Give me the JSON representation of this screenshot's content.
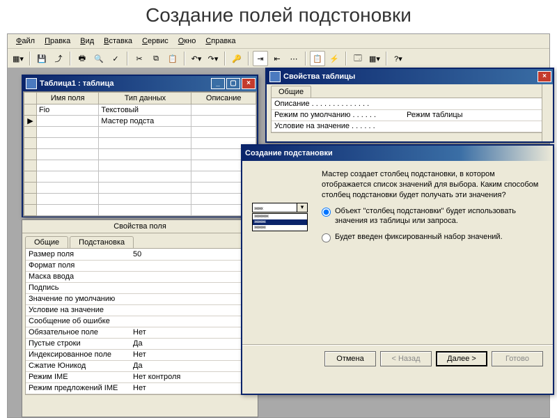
{
  "slide": {
    "title": "Создание полей подстоновки"
  },
  "menubar": [
    {
      "u": "Ф",
      "r": "айл"
    },
    {
      "u": "П",
      "r": "равка"
    },
    {
      "u": "В",
      "r": "ид"
    },
    {
      "u": "В",
      "r": "ставка"
    },
    {
      "u": "С",
      "r": "ервис"
    },
    {
      "u": "О",
      "r": "кно"
    },
    {
      "u": "С",
      "r": "правка"
    }
  ],
  "tableWin": {
    "title": "Таблица1 : таблица",
    "cols": [
      "Имя поля",
      "Тип данных",
      "Описание"
    ],
    "rows": [
      {
        "name": "Fio",
        "type": "Текстовый"
      },
      {
        "name": "",
        "type": "Мастер подста"
      }
    ]
  },
  "fieldProps": {
    "title": "Свойства поля",
    "tabs": [
      "Общие",
      "Подстановка"
    ],
    "rows": [
      {
        "n": "Размер поля",
        "v": "50"
      },
      {
        "n": "Формат поля",
        "v": ""
      },
      {
        "n": "Маска ввода",
        "v": ""
      },
      {
        "n": "Подпись",
        "v": ""
      },
      {
        "n": "Значение по умолчанию",
        "v": ""
      },
      {
        "n": "Условие на значение",
        "v": ""
      },
      {
        "n": "Сообщение об ошибке",
        "v": ""
      },
      {
        "n": "Обязательное поле",
        "v": "Нет"
      },
      {
        "n": "Пустые строки",
        "v": "Да"
      },
      {
        "n": "Индексированное поле",
        "v": "Нет"
      },
      {
        "n": "Сжатие Юникод",
        "v": "Да"
      },
      {
        "n": "Режим IME",
        "v": "Нет контроля"
      },
      {
        "n": "Режим предложений IME",
        "v": "Нет"
      }
    ]
  },
  "tprops": {
    "title": "Свойства таблицы",
    "tab": "Общие",
    "rows": [
      {
        "n": "Описание  . . . . . . . . . . . . . .",
        "v": ""
      },
      {
        "n": "Режим по умолчанию  . . . . . .",
        "v": "Режим таблицы"
      },
      {
        "n": "Условие на значение  . . . . . .",
        "v": ""
      }
    ]
  },
  "wizard": {
    "title": "Создание  подстановки",
    "intro": "Мастер создает столбец подстановки, в котором отображается список значений для выбора.  Каким способом столбец подстановки будет получать эти значения?",
    "option1": "Объект \"столбец подстановки\" будет использовать значения из таблицы или запроса.",
    "option2": "Будет введен фиксированный набор значений.",
    "img_items": [
      "xxxxxx",
      "xxxxxxxxxx",
      "xxxxxxxx",
      "xxxxxxxx"
    ],
    "buttons": {
      "cancel": "Отмена",
      "back": "< Назад",
      "next": "Далее >",
      "finish": "Готово"
    }
  }
}
